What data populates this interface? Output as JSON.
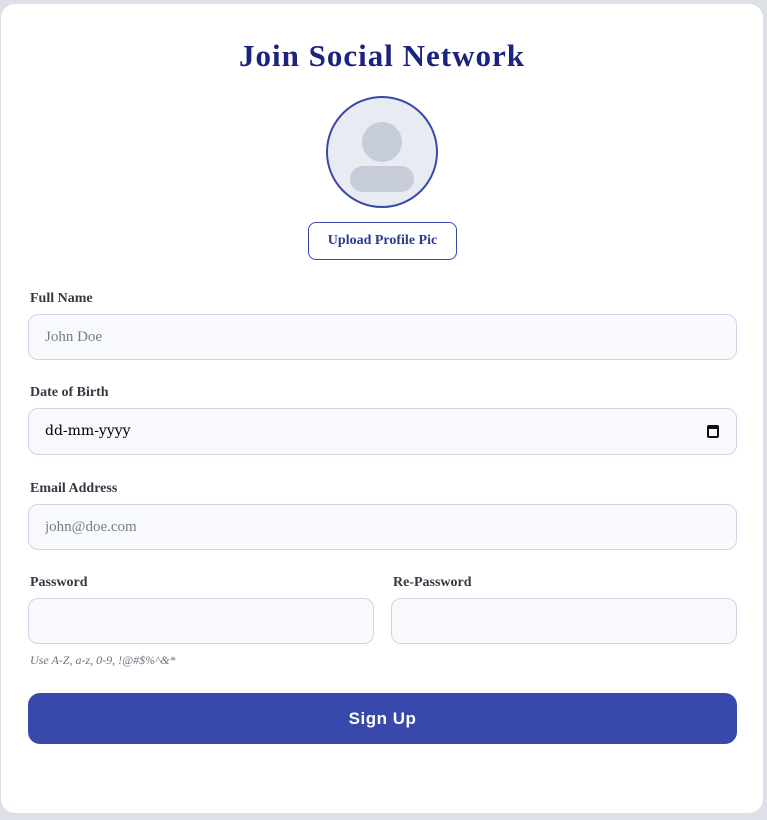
{
  "form": {
    "title": "Join Social Network",
    "upload_label": "Upload Profile Pic",
    "full_name": {
      "label": "Full Name",
      "placeholder": "John Doe",
      "value": ""
    },
    "dob": {
      "label": "Date of Birth",
      "placeholder": "dd-mm-yyyy"
    },
    "email": {
      "label": "Email Address",
      "placeholder": "john@doe.com",
      "value": ""
    },
    "password": {
      "label": "Password",
      "value": ""
    },
    "repassword": {
      "label": "Re-Password",
      "value": ""
    },
    "password_hint": "Use A-Z, a-z, 0-9, !@#$%^&*",
    "submit_label": "Sign Up"
  },
  "icons": {
    "avatar": "user-silhouette-icon",
    "date_picker": "calendar-icon"
  },
  "colors": {
    "accent": "#3949ab",
    "title": "#1a237e",
    "field_bg": "#f8f9fd",
    "field_border": "#cfd5e3",
    "page_bg": "#dde0e6"
  }
}
